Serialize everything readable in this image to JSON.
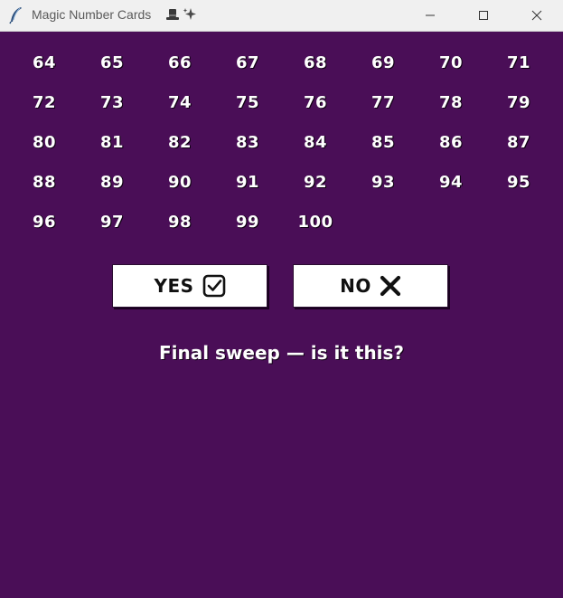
{
  "window": {
    "title": "Magic Number Cards",
    "title_icons": [
      "hat-icon",
      "sparkles-icon"
    ]
  },
  "card": {
    "numbers": [
      "64",
      "65",
      "66",
      "67",
      "68",
      "69",
      "70",
      "71",
      "72",
      "73",
      "74",
      "75",
      "76",
      "77",
      "78",
      "79",
      "80",
      "81",
      "82",
      "83",
      "84",
      "85",
      "86",
      "87",
      "88",
      "89",
      "90",
      "91",
      "92",
      "93",
      "94",
      "95",
      "96",
      "97",
      "98",
      "99",
      "100"
    ]
  },
  "buttons": {
    "yes_label": "YES",
    "yes_icon": "checkbox-icon",
    "no_label": "NO",
    "no_icon": "cross-icon"
  },
  "prompt": "Final sweep — is it this?",
  "colors": {
    "background": "#4a0e57",
    "text": "#ffffff",
    "button_bg": "#ffffff",
    "button_text": "#111111"
  }
}
